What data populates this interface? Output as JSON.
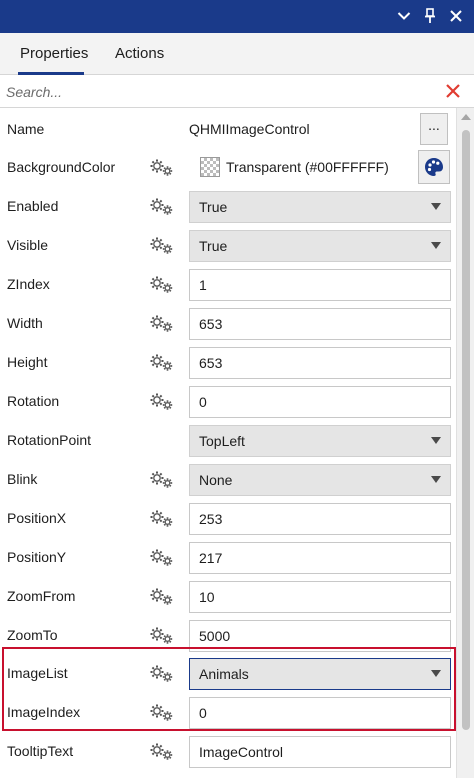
{
  "window": {
    "buttons": [
      {
        "icon": "chevron-down-icon"
      },
      {
        "icon": "pin-icon"
      },
      {
        "icon": "close-icon"
      }
    ]
  },
  "tabs": [
    {
      "label": "Properties",
      "active": true
    },
    {
      "label": "Actions",
      "active": false
    }
  ],
  "search": {
    "placeholder": "Search...",
    "value": "",
    "clear_icon": "clear-search-icon",
    "clear_color": "#e03c31"
  },
  "colors": {
    "accent": "#1a3a8a",
    "highlight_border": "#c8102e"
  },
  "properties": [
    {
      "name": "Name",
      "value": "QHMIImageControl",
      "editor": "readonly-with-button",
      "button_label": "..."
    },
    {
      "name": "BackgroundColor",
      "value": "Transparent (#00FFFFFF)",
      "editor": "color"
    },
    {
      "name": "Enabled",
      "value": "True",
      "editor": "dropdown"
    },
    {
      "name": "Visible",
      "value": "True",
      "editor": "dropdown"
    },
    {
      "name": "ZIndex",
      "value": "1",
      "editor": "text"
    },
    {
      "name": "Width",
      "value": "653",
      "editor": "text"
    },
    {
      "name": "Height",
      "value": "653",
      "editor": "text"
    },
    {
      "name": "Rotation",
      "value": "0",
      "editor": "text"
    },
    {
      "name": "RotationPoint",
      "value": "TopLeft",
      "editor": "dropdown"
    },
    {
      "name": "Blink",
      "value": "None",
      "editor": "dropdown"
    },
    {
      "name": "PositionX",
      "value": "253",
      "editor": "text"
    },
    {
      "name": "PositionY",
      "value": "217",
      "editor": "text"
    },
    {
      "name": "ZoomFrom",
      "value": "10",
      "editor": "text"
    },
    {
      "name": "ZoomTo",
      "value": "5000",
      "editor": "text"
    },
    {
      "name": "ImageList",
      "value": "Animals",
      "editor": "dropdown",
      "highlighted": true
    },
    {
      "name": "ImageIndex",
      "value": "0",
      "editor": "text",
      "highlighted": true
    },
    {
      "name": "TooltipText",
      "value": "ImageControl",
      "editor": "text"
    }
  ]
}
